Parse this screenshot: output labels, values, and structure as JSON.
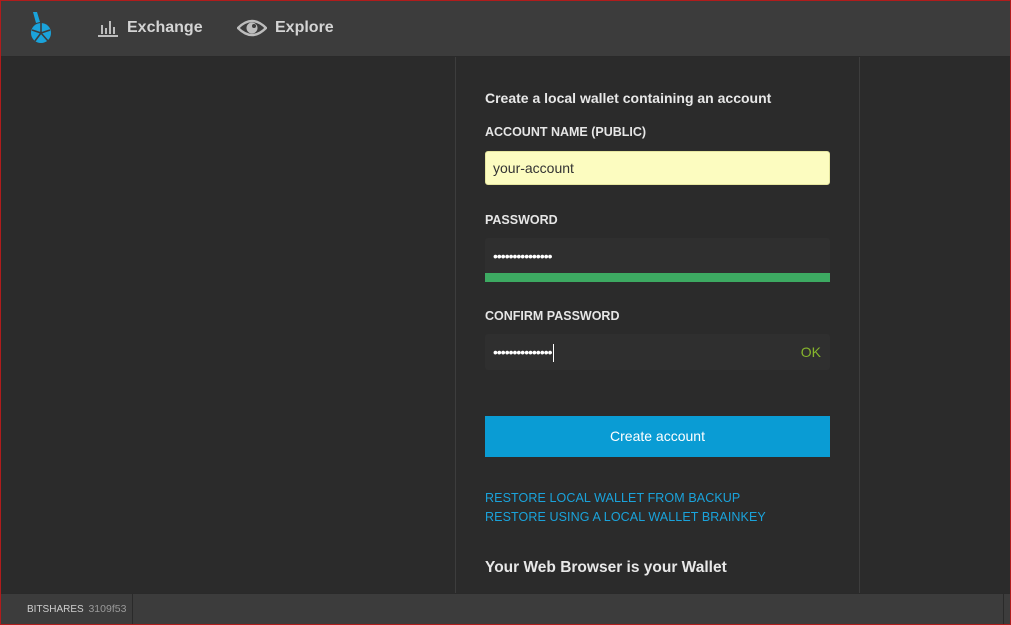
{
  "nav": {
    "exchange_label": "Exchange",
    "explore_label": "Explore"
  },
  "form": {
    "heading": "Create a local wallet containing an account",
    "account_label": "ACCOUNT NAME (PUBLIC)",
    "account_value": "your-account",
    "password_label": "PASSWORD",
    "password_value": "•••••••••••••••",
    "confirm_label": "CONFIRM PASSWORD",
    "confirm_value": "•••••••••••••••",
    "confirm_status": "OK",
    "create_button": "Create account",
    "restore_backup_link": "RESTORE LOCAL WALLET FROM BACKUP",
    "restore_brainkey_link": "RESTORE USING A LOCAL WALLET BRAINKEY",
    "sub_heading": "Your Web Browser is your Wallet"
  },
  "footer": {
    "app_name": "BITSHARES",
    "version": "3109f53"
  },
  "colors": {
    "accent": "#0a9cd4",
    "link": "#1aa3db",
    "strength_ok": "#3daa62",
    "ok_text": "#86b52c",
    "account_bg": "#fcfcc0"
  },
  "icons": {
    "logo": "bitshares-logo-icon",
    "exchange": "bar-chart-icon",
    "explore": "eye-icon"
  }
}
